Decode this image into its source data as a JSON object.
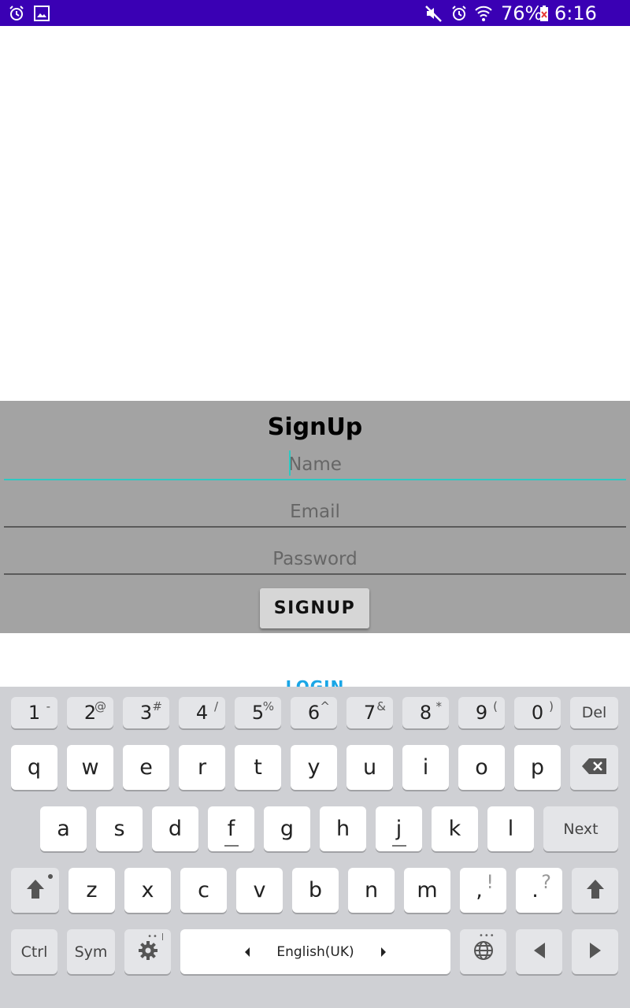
{
  "status_bar": {
    "battery": "76%",
    "time": "6:16 pm",
    "icons": [
      "alarm-icon",
      "gallery-icon",
      "mute-icon",
      "alarm-icon",
      "wifi-icon",
      "battery-icon"
    ]
  },
  "form": {
    "title": "SignUp",
    "name_placeholder": "Name",
    "email_placeholder": "Email",
    "password_placeholder": "Password",
    "signup_label": "SIGNUP",
    "login_label": "LOGIN"
  },
  "keyboard": {
    "number_row": [
      {
        "main": "1",
        "sub": "-"
      },
      {
        "main": "2",
        "sub": "@"
      },
      {
        "main": "3",
        "sub": "#"
      },
      {
        "main": "4",
        "sub": "/"
      },
      {
        "main": "5",
        "sub": "%"
      },
      {
        "main": "6",
        "sub": "^"
      },
      {
        "main": "7",
        "sub": "&"
      },
      {
        "main": "8",
        "sub": "*"
      },
      {
        "main": "9",
        "sub": "("
      },
      {
        "main": "0",
        "sub": ")"
      }
    ],
    "del_label": "Del",
    "row1": [
      "q",
      "w",
      "e",
      "r",
      "t",
      "y",
      "u",
      "i",
      "o",
      "p"
    ],
    "row2": [
      "a",
      "s",
      "d",
      "f",
      "g",
      "h",
      "j",
      "k",
      "l"
    ],
    "next_label": "Next",
    "row3": [
      "z",
      "x",
      "c",
      "v",
      "b",
      "n",
      "m"
    ],
    "comma_key": {
      "main": ",",
      "sub": "!"
    },
    "period_key": {
      "main": ".",
      "sub": "?"
    },
    "ctrl_label": "Ctrl",
    "sym_label": "Sym",
    "space_label": "English(UK)"
  },
  "colors": {
    "status_bar": "#3a00b4",
    "panel": "#a3a3a3",
    "focus_accent": "#2fc8c2",
    "login_link": "#1aa6e6",
    "keyboard_bg": "#cfd0d4"
  }
}
